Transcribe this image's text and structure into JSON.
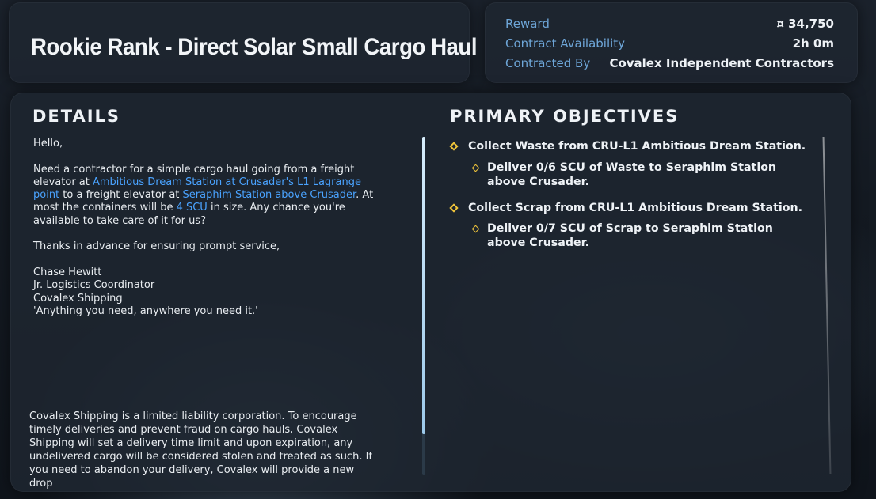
{
  "contract": {
    "title": "Rookie Rank - Direct Solar Small Cargo Haul"
  },
  "info": {
    "reward_label": "Reward",
    "reward_value": "¤ 34,750",
    "availability_label": "Contract Availability",
    "availability_value": "2h 0m",
    "contracted_by_label": "Contracted By",
    "contracted_by_value": "Covalex Independent Contractors"
  },
  "details": {
    "heading": "DETAILS",
    "greeting": "Hello,",
    "p1_a": "Need a contractor for a simple cargo haul going from a freight elevator at ",
    "p1_link1": "Ambitious Dream Station at Crusader's L1 Lagrange point",
    "p1_b": " to a freight elevator at ",
    "p1_link2": "Seraphim Station above Crusader",
    "p1_c": ". At most the containers will be ",
    "p1_link3": "4 SCU",
    "p1_d": " in size. Any chance you're available to take care of it for us?",
    "p2": "Thanks in advance for ensuring prompt service,",
    "sig_name": "Chase Hewitt",
    "sig_role": "Jr. Logistics Coordinator",
    "sig_company": "Covalex Shipping",
    "sig_motto": "'Anything you need, anywhere you need it.'",
    "legal": "Covalex Shipping is a limited liability corporation. To encourage timely deliveries and prevent fraud on cargo hauls, Covalex Shipping will set a delivery time limit and upon expiration, any undelivered cargo will be considered stolen and treated as such. If you need to abandon your delivery, Covalex will provide a new drop"
  },
  "objectives": {
    "heading": "PRIMARY OBJECTIVES",
    "items": [
      {
        "text": "Collect Waste from CRU-L1 Ambitious Dream Station.",
        "sub": "Deliver 0/6 SCU of Waste to Seraphim Station above Crusader."
      },
      {
        "text": "Collect Scrap from CRU-L1 Ambitious Dream Station.",
        "sub": "Deliver 0/7 SCU of Scrap to Seraphim Station above Crusader."
      }
    ]
  },
  "colors": {
    "accent_link": "#4aa3ff",
    "label_blue": "#6ea6d8",
    "objective_marker": "#f0c53a"
  }
}
